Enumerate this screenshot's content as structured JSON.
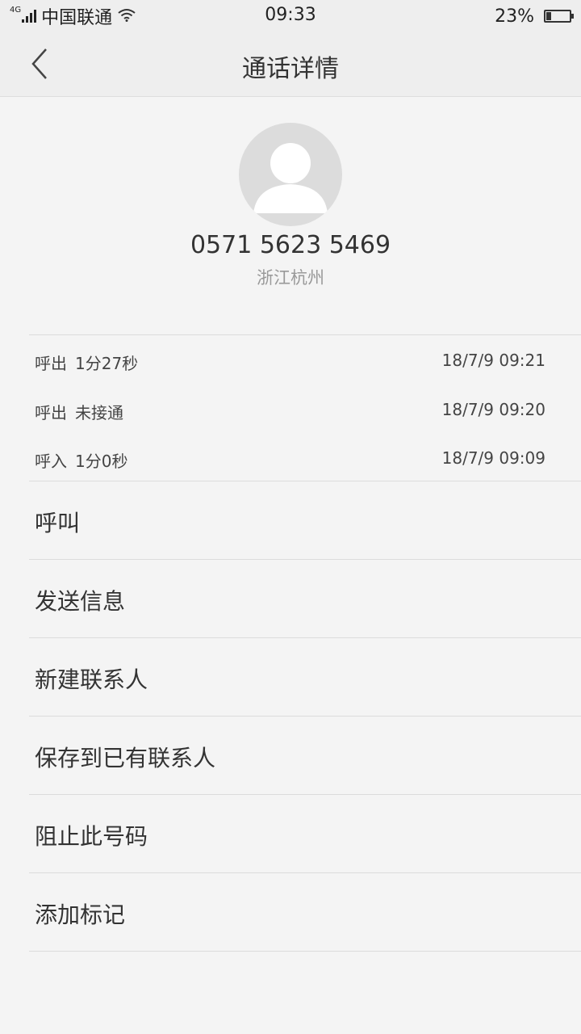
{
  "status_bar": {
    "network_type": "4G",
    "carrier": "中国联通",
    "time": "09:33",
    "battery_percent_label": "23%",
    "battery_level": 0.23,
    "icons": [
      "signal-icon",
      "wifi-icon",
      "battery-icon"
    ]
  },
  "header": {
    "title": "通话详情",
    "back_icon": "chevron-left-icon"
  },
  "contact": {
    "avatar_icon": "default-avatar-icon",
    "phone_number": "0571 5623 5469",
    "location": "浙江杭州"
  },
  "call_log": [
    {
      "type": "呼出",
      "duration": "1分27秒",
      "time": "18/7/9 09:21"
    },
    {
      "type": "呼出",
      "duration": "未接通",
      "time": "18/7/9 09:20"
    },
    {
      "type": "呼入",
      "duration": "1分0秒",
      "time": "18/7/9 09:09"
    }
  ],
  "actions": [
    {
      "label": "呼叫"
    },
    {
      "label": "发送信息"
    },
    {
      "label": "新建联系人"
    },
    {
      "label": "保存到已有联系人"
    },
    {
      "label": "阻止此号码"
    },
    {
      "label": "添加标记"
    }
  ]
}
